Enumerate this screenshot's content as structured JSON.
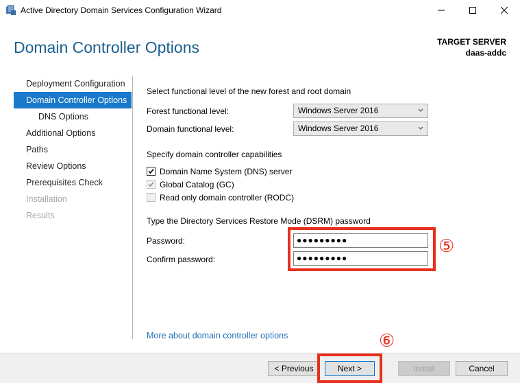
{
  "window": {
    "title": "Active Directory Domain Services Configuration Wizard"
  },
  "header": {
    "title": "Domain Controller Options",
    "target_label": "TARGET SERVER",
    "target_name": "daas-addc"
  },
  "nav": {
    "items": [
      {
        "label": "Deployment Configuration",
        "state": "normal"
      },
      {
        "label": "Domain Controller Options",
        "state": "selected"
      },
      {
        "label": "DNS Options",
        "state": "sub"
      },
      {
        "label": "Additional Options",
        "state": "normal"
      },
      {
        "label": "Paths",
        "state": "normal"
      },
      {
        "label": "Review Options",
        "state": "normal"
      },
      {
        "label": "Prerequisites Check",
        "state": "normal"
      },
      {
        "label": "Installation",
        "state": "disabled"
      },
      {
        "label": "Results",
        "state": "disabled"
      }
    ]
  },
  "main": {
    "functional_heading": "Select functional level of the new forest and root domain",
    "forest_label": "Forest functional level:",
    "forest_value": "Windows Server 2016",
    "domain_label": "Domain functional level:",
    "domain_value": "Windows Server 2016",
    "capabilities_heading": "Specify domain controller capabilities",
    "dns_label": "Domain Name System (DNS) server",
    "gc_label": "Global Catalog (GC)",
    "rodc_label": "Read only domain controller (RODC)",
    "dsrm_heading": "Type the Directory Services Restore Mode (DSRM) password",
    "password_label": "Password:",
    "password_value": "●●●●●●●●●",
    "confirm_label": "Confirm password:",
    "confirm_value": "●●●●●●●●●",
    "more_link": "More about domain controller options"
  },
  "annotations": {
    "step5": "⑤",
    "step6": "⑥",
    "color": "#e8301c"
  },
  "footer": {
    "previous": "< Previous",
    "next": "Next >",
    "install": "Install",
    "cancel": "Cancel"
  },
  "icons": [
    "app-icon",
    "minimize-icon",
    "maximize-icon",
    "close-icon",
    "chevron-down-icon",
    "checkmark-icon"
  ]
}
